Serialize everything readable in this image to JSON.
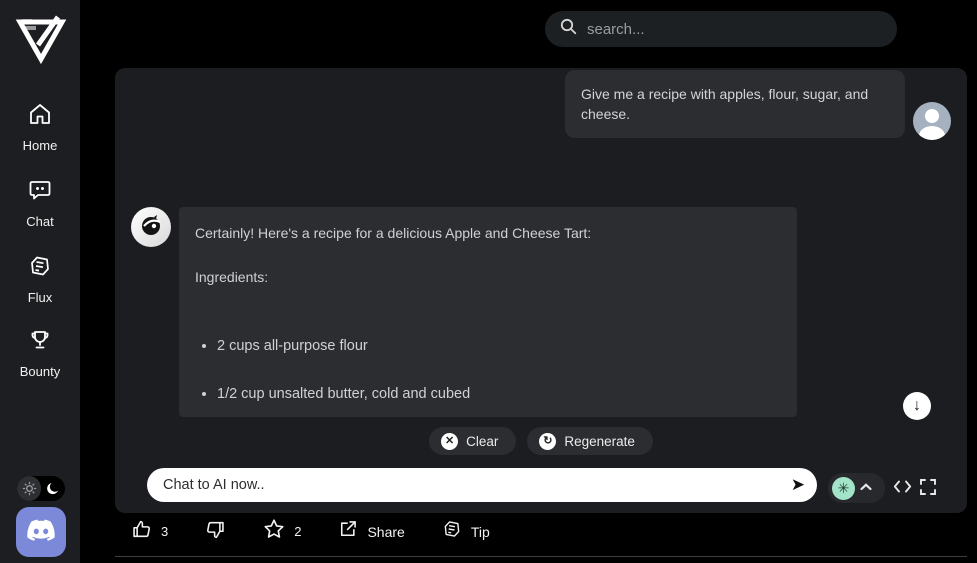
{
  "sidebar": {
    "items": [
      {
        "icon": "home-icon",
        "label": "Home"
      },
      {
        "icon": "chat-icon",
        "label": "Chat"
      },
      {
        "icon": "flux-icon",
        "label": "Flux"
      },
      {
        "icon": "bounty-icon",
        "label": "Bounty"
      }
    ],
    "theme_toggle": {
      "options": [
        "light",
        "dark"
      ],
      "selected": "dark"
    },
    "discord_button": "discord"
  },
  "search": {
    "placeholder": "search..."
  },
  "chat": {
    "user_message": "Give me a recipe with apples, flour, sugar, and cheese.",
    "ai_message": {
      "intro": "Certainly! Here's a recipe for a delicious Apple and Cheese Tart:",
      "section_heading": "Ingredients:",
      "ingredients": [
        "2 cups all-purpose flour",
        "1/2 cup unsalted butter, cold and cubed"
      ]
    },
    "clear_label": "Clear",
    "regenerate_label": "Regenerate",
    "input_placeholder": "Chat to AI now..",
    "send_glyph": "➤",
    "scroll_down_glyph": "↓"
  },
  "actions": {
    "like_count": "3",
    "star_count": "2",
    "share_label": "Share",
    "tip_label": "Tip"
  },
  "colors": {
    "page_bg": "#000000",
    "sidebar_bg": "#1c1e21",
    "panel_bg": "#1b1d20",
    "bubble_bg": "#2b2d31",
    "discord_accent": "#7c89d8",
    "model_icon_bg": "#a3e4c9",
    "input_bg": "#ffffff"
  }
}
